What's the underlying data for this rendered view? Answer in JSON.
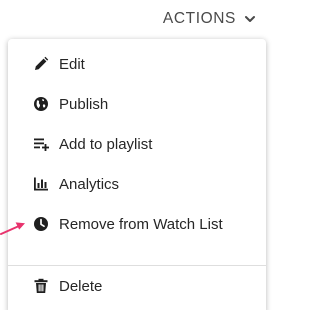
{
  "header": {
    "actions_label": "ACTIONS",
    "chevron_icon": "chevron-down-icon"
  },
  "menu": {
    "items": [
      {
        "label": "Edit",
        "icon": "pencil-icon"
      },
      {
        "label": "Publish",
        "icon": "globe-icon"
      },
      {
        "label": "Add to playlist",
        "icon": "playlist-add-icon"
      },
      {
        "label": "Analytics",
        "icon": "bar-chart-icon"
      },
      {
        "label": "Remove from Watch List",
        "icon": "clock-icon"
      },
      {
        "label": "Delete",
        "icon": "trash-icon"
      }
    ]
  },
  "colors": {
    "text": "#262626",
    "header_text": "#4a4a4a",
    "annotation_arrow": "#e8336d"
  }
}
